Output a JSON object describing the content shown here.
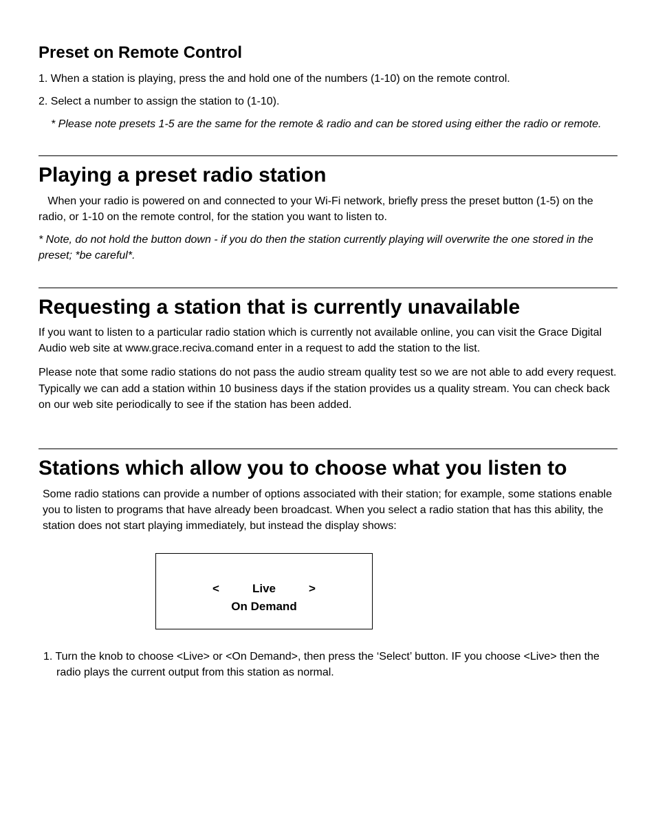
{
  "section1": {
    "heading": "Preset on Remote Control",
    "item1": "1.  When a station is playing, press the and hold one of the numbers (1-10) on the remote control.",
    "item2": "2. Select a number to assign the station to (1-10).",
    "note": "* Please note presets 1-5 are the same for the remote & radio and can be stored using either the radio or remote."
  },
  "section2": {
    "heading": "Playing a preset radio station",
    "body": "   When your radio is powered on and connected to your Wi-Fi network, briefly press the preset button (1-5) on the radio, or 1-10 on the remote control, for the station you want to listen to.",
    "note": "* Note, do not hold the button down - if you do then the station currently playing will overwrite the one stored in the preset; *be careful*."
  },
  "section3": {
    "heading": "Requesting a station that is currently unavailable",
    "p1": "If you want to listen to a particular radio station which is currently not available online, you can visit the Grace Digital Audio web site at www.grace.reciva.comand enter in a request to add the station to the list.",
    "p2": "Please note that some radio stations do not pass the audio stream quality test so we are not able to add every request. Typically we can add a station within 10 business days if the station provides us a quality stream. You can check back on our web site periodically to see if the station has been added."
  },
  "section4": {
    "heading": "Stations which allow you to choose what you listen to",
    "p1": "Some radio stations can provide a number of options associated with their station; for example, some stations enable you to listen to programs that have already been broadcast. When you select a radio station that has this ability, the station does not start playing immediately, but instead the display shows:",
    "display": {
      "left": "<",
      "center": "Live",
      "right": ">",
      "line2": "On Demand"
    },
    "item1": "1.  Turn the knob to choose <Live> or <On Demand>, then press the ‘Select’ button.  IF you choose <Live> then the radio plays the current output from this station as normal."
  }
}
